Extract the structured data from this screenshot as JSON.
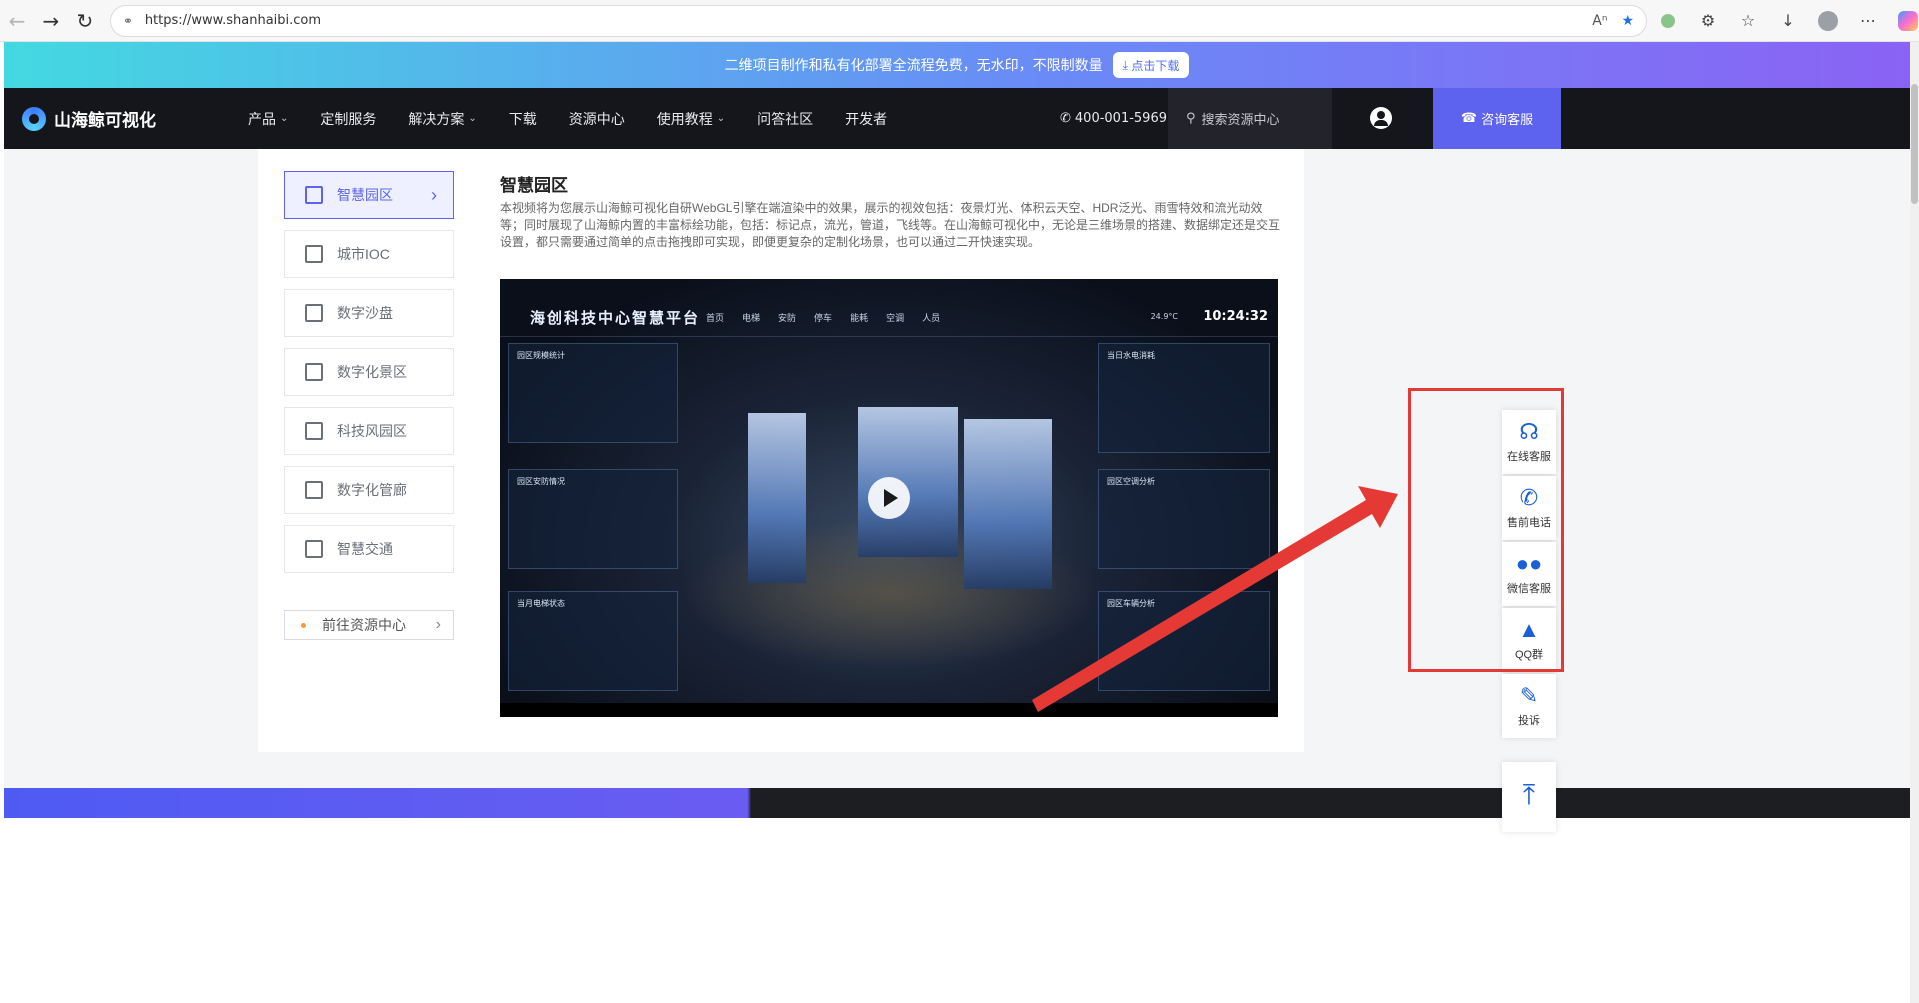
{
  "browser": {
    "url": "https://www.shanhaibi.com",
    "back_icon": "arrow-left",
    "forward_icon": "arrow-right",
    "reload_icon": "reload"
  },
  "promo": {
    "text": "二维项目制作和私有化部署全流程免费，无水印，不限制数量",
    "button": "点击下载"
  },
  "nav": {
    "logo": "山海鲸可视化",
    "items": [
      {
        "label": "产品",
        "dropdown": true
      },
      {
        "label": "定制服务",
        "dropdown": false
      },
      {
        "label": "解决方案",
        "dropdown": true
      },
      {
        "label": "下载",
        "dropdown": false
      },
      {
        "label": "资源中心",
        "dropdown": false
      },
      {
        "label": "使用教程",
        "dropdown": true
      },
      {
        "label": "问答社区",
        "dropdown": false
      },
      {
        "label": "开发者",
        "dropdown": false
      }
    ],
    "phone": "400-001-5969",
    "search_placeholder": "搜索资源中心",
    "consult": "咨询客服"
  },
  "sidebar": {
    "items": [
      {
        "label": "智慧园区",
        "active": true
      },
      {
        "label": "城市IOC",
        "active": false
      },
      {
        "label": "数字沙盘",
        "active": false
      },
      {
        "label": "数字化景区",
        "active": false
      },
      {
        "label": "科技风园区",
        "active": false
      },
      {
        "label": "数字化管廊",
        "active": false
      },
      {
        "label": "智慧交通",
        "active": false
      }
    ],
    "resource_link": "前往资源中心"
  },
  "article": {
    "title": "智慧园区",
    "body": "本视频将为您展示山海鲸可视化自研WebGL引擎在端渲染中的效果，展示的视效包括：夜景灯光、体积云天空、HDR泛光、雨雪特效和流光动效等；同时展现了山海鲸内置的丰富标绘功能，包括：标记点，流光，管道，飞线等。在山海鲸可视化中，无论是三维场景的搭建、数据绑定还是交互设置，都只需要通过简单的点击拖拽即可实现，即便更复杂的定制化场景，也可以通过二开快速实现。"
  },
  "video": {
    "title": "海创科技中心智慧平台",
    "tabs": [
      "首页",
      "电梯",
      "安防",
      "停车",
      "能耗",
      "空调",
      "人员"
    ],
    "time": "10:24:32",
    "weather": "24.9°C",
    "panels": {
      "stats": "园区规模统计",
      "security": "园区安防情况",
      "elevator": "当月电梯状态",
      "water": "当日水电消耗",
      "aircon": "园区空调分析",
      "parking": "园区车辆分析"
    }
  },
  "float_bar": {
    "items": [
      {
        "label": "在线客服",
        "icon": "headset-icon"
      },
      {
        "label": "售前电话",
        "icon": "phone-icon"
      },
      {
        "label": "微信客服",
        "icon": "wechat-icon"
      },
      {
        "label": "QQ群",
        "icon": "qq-icon"
      },
      {
        "label": "投诉",
        "icon": "complaint-icon"
      }
    ],
    "top_icon": "back-to-top-icon"
  },
  "annotation": {
    "box_color": "#e53935",
    "arrow_color": "#e53935"
  }
}
